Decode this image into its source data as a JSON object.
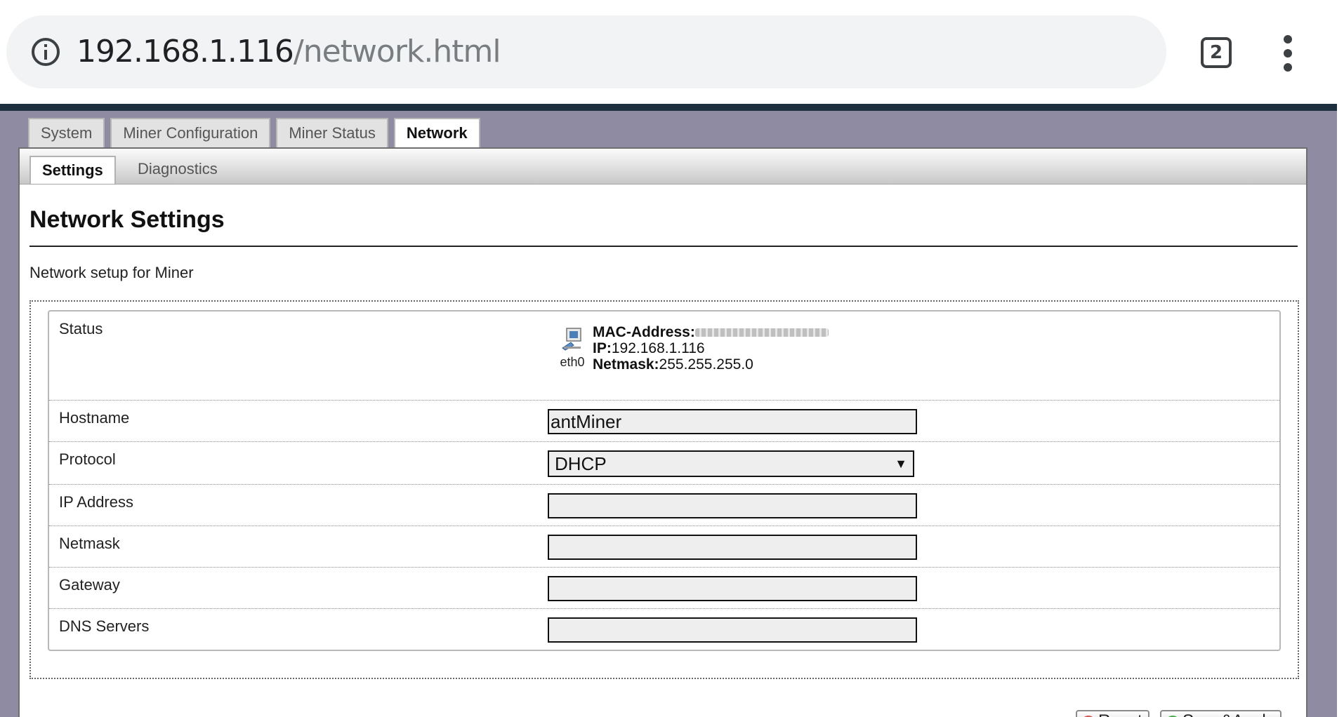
{
  "browser": {
    "url_host": "192.168.1.116",
    "url_path": "/network.html",
    "tab_count": "2",
    "icons": [
      "info-icon",
      "tab-switcher-icon",
      "menu-icon"
    ]
  },
  "main_tabs": [
    {
      "label": "System",
      "active": false
    },
    {
      "label": "Miner Configuration",
      "active": false
    },
    {
      "label": "Miner Status",
      "active": false
    },
    {
      "label": "Network",
      "active": true
    }
  ],
  "sub_tabs": [
    {
      "label": "Settings",
      "active": true
    },
    {
      "label": "Diagnostics",
      "active": false
    }
  ],
  "page": {
    "title": "Network Settings",
    "description": "Network setup for Miner"
  },
  "form": {
    "status": {
      "label": "Status",
      "interface": "eth0",
      "mac_label": "MAC-Address:",
      "ip_label": "IP:",
      "ip_value": "192.168.1.116",
      "netmask_label": "Netmask:",
      "netmask_value": "255.255.255.0"
    },
    "hostname": {
      "label": "Hostname",
      "value": "antMiner"
    },
    "protocol": {
      "label": "Protocol",
      "value": "DHCP"
    },
    "ip_address": {
      "label": "IP Address",
      "value": ""
    },
    "netmask": {
      "label": "Netmask",
      "value": ""
    },
    "gateway": {
      "label": "Gateway",
      "value": ""
    },
    "dns_servers": {
      "label": "DNS Servers",
      "value": ""
    }
  },
  "actions": {
    "reset_label": "Reset",
    "save_label": "Save&Apply"
  },
  "colors": {
    "page_background": "#8e8ba2",
    "top_line": "#1e2f3f",
    "reset_icon": "#d9534f",
    "save_icon": "#3fae49"
  }
}
